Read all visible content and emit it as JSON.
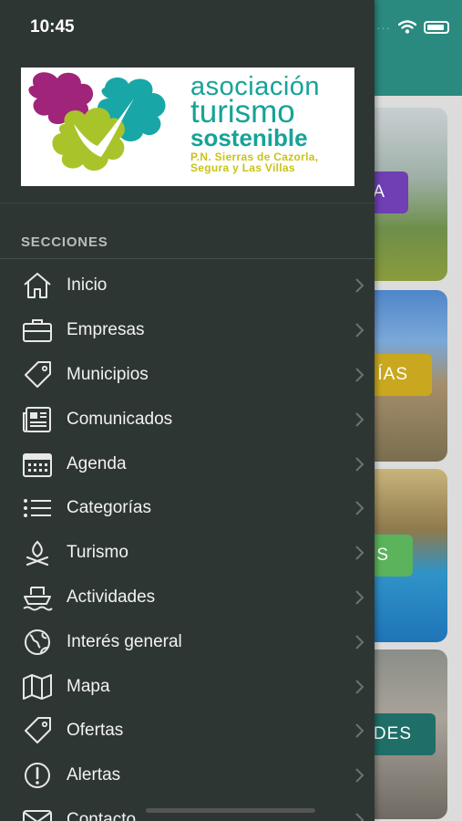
{
  "status": {
    "time": "10:45"
  },
  "logo": {
    "line1": "asociación",
    "line2": "turismo",
    "line3": "sostenible",
    "line4": "P.N. Sierras de Cazorla,",
    "line5": "Segura y Las Villas"
  },
  "section_title": "SECCIONES",
  "menu": [
    {
      "label": "Inicio",
      "icon": "home-icon"
    },
    {
      "label": "Empresas",
      "icon": "briefcase-icon"
    },
    {
      "label": "Municipios",
      "icon": "tag-icon"
    },
    {
      "label": "Comunicados",
      "icon": "newspaper-icon"
    },
    {
      "label": "Agenda",
      "icon": "calendar-icon"
    },
    {
      "label": "Categorías",
      "icon": "list-icon"
    },
    {
      "label": "Turismo",
      "icon": "campfire-icon"
    },
    {
      "label": "Actividades",
      "icon": "boat-icon"
    },
    {
      "label": "Interés general",
      "icon": "globe-icon"
    },
    {
      "label": "Mapa",
      "icon": "map-icon"
    },
    {
      "label": "Ofertas",
      "icon": "tag-icon"
    },
    {
      "label": "Alertas",
      "icon": "alert-icon"
    },
    {
      "label": "Contacto",
      "icon": "mail-icon"
    }
  ],
  "background_chips": [
    "A",
    "ÍAS",
    "S",
    "DES"
  ],
  "colors": {
    "drawer": "#2e3634",
    "header": "#2a8a7f",
    "logo_teal": "#16a398",
    "logo_yellow": "#c9c318"
  }
}
